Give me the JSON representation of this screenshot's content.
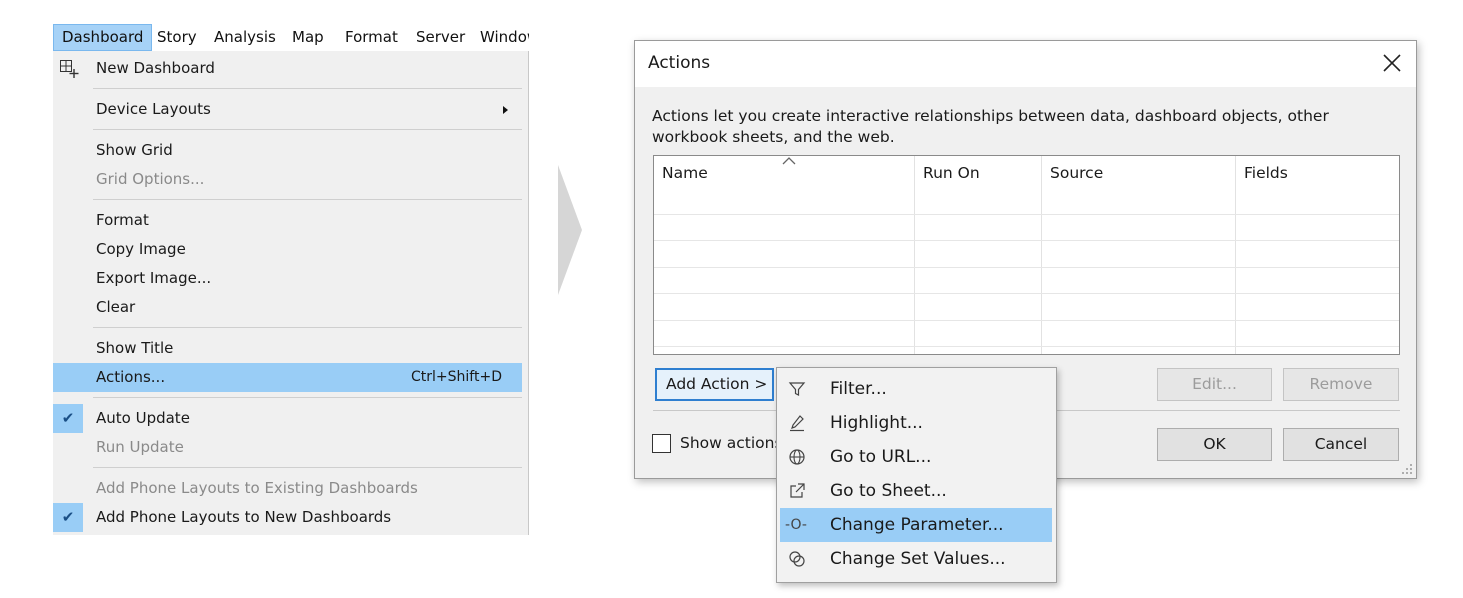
{
  "menubar": {
    "items": [
      "Dashboard",
      "Story",
      "Analysis",
      "Map",
      "Format",
      "Server",
      "Window"
    ]
  },
  "dashboard_menu": {
    "new_dashboard": "New Dashboard",
    "device_layouts": "Device Layouts",
    "show_grid": "Show Grid",
    "grid_options": "Grid Options...",
    "format": "Format",
    "copy_image": "Copy Image",
    "export_image": "Export Image...",
    "clear": "Clear",
    "show_title": "Show Title",
    "actions": "Actions...",
    "actions_shortcut": "Ctrl+Shift+D",
    "auto_update": "Auto Update",
    "run_update": "Run Update",
    "add_phone_existing": "Add Phone Layouts to Existing Dashboards",
    "add_phone_new": "Add Phone Layouts to New Dashboards",
    "check_mark": "✔"
  },
  "dialog": {
    "title": "Actions",
    "description": "Actions let you create interactive relationships between data, dashboard objects, other workbook sheets, and the web.",
    "columns": [
      "Name",
      "Run On",
      "Source",
      "Fields"
    ],
    "add_action_label": "Add Action >",
    "edit_label": "Edit...",
    "remove_label": "Remove",
    "show_actions_label": "Show actions",
    "ok_label": "OK",
    "cancel_label": "Cancel"
  },
  "add_action_menu": {
    "items": [
      {
        "label": "Filter...",
        "icon": "filter-icon"
      },
      {
        "label": "Highlight...",
        "icon": "highlight-icon"
      },
      {
        "label": "Go to URL...",
        "icon": "globe-icon"
      },
      {
        "label": "Go to Sheet...",
        "icon": "external-link-icon"
      },
      {
        "label": "Change Parameter...",
        "icon": "parameter-icon"
      },
      {
        "label": "Change Set Values...",
        "icon": "set-icon"
      }
    ],
    "parameter_glyph": "-O-"
  },
  "colors": {
    "menu_highlight": "#99cdf6",
    "menubar_active": "#a6d2f7",
    "focus_border": "#2f7fd0"
  }
}
